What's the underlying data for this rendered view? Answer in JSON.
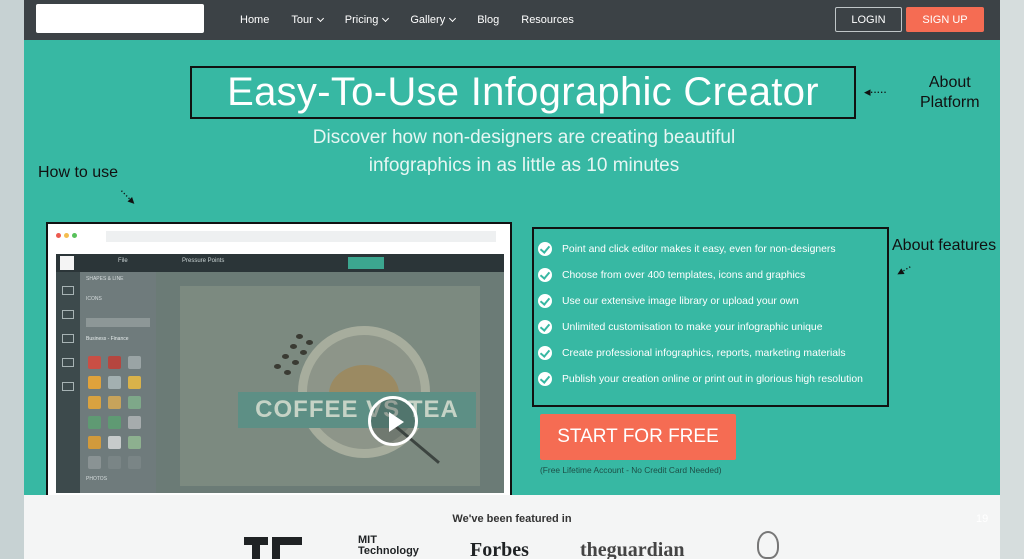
{
  "nav": {
    "items": [
      {
        "label": "Home",
        "dropdown": false
      },
      {
        "label": "Tour",
        "dropdown": true
      },
      {
        "label": "Pricing",
        "dropdown": true
      },
      {
        "label": "Gallery",
        "dropdown": true
      },
      {
        "label": "Blog",
        "dropdown": false
      },
      {
        "label": "Resources",
        "dropdown": false
      }
    ],
    "login_label": "LOGIN",
    "signup_label": "SIGN UP"
  },
  "hero": {
    "title": "Easy-To-Use Infographic Creator",
    "subtitle_line1": "Discover how non-designers are creating beautiful",
    "subtitle_line2": "infographics in as little as 10 minutes"
  },
  "annotations": {
    "about_platform_line1": "About",
    "about_platform_line2": "Platform",
    "how_to_use": "How to use",
    "about_features": "About features"
  },
  "video": {
    "app_file_menu": "File",
    "app_doc_name": "Pressure Points",
    "app_panel_heading": "SHAPES & LINE",
    "app_panel_icons": "ICONS",
    "app_panel_select": "Business - Finance",
    "app_panel_photos": "PHOTOS",
    "canvas_banner": "COFFEE VS TEA"
  },
  "features": [
    "Point and click editor makes it easy, even for non-designers",
    "Choose from over 400 templates, icons and graphics",
    "Use our extensive image library or upload your own",
    "Unlimited customisation to make your infographic unique",
    "Create professional infographics, reports, marketing materials",
    "Publish your creation online or print out in glorious high resolution"
  ],
  "cta": {
    "label": "START FOR FREE",
    "note": "(Free Lifetime Account - No Credit Card Needed)"
  },
  "featured": {
    "title": "We've been featured in",
    "mit_line1": "MIT",
    "mit_line2": "Technology",
    "forbes": "Forbes",
    "guardian": "theguardian",
    "side_number": "19"
  },
  "colors": {
    "nav_bg": "#3c4246",
    "hero_bg": "#37b8a3",
    "accent_orange": "#f56c53"
  }
}
